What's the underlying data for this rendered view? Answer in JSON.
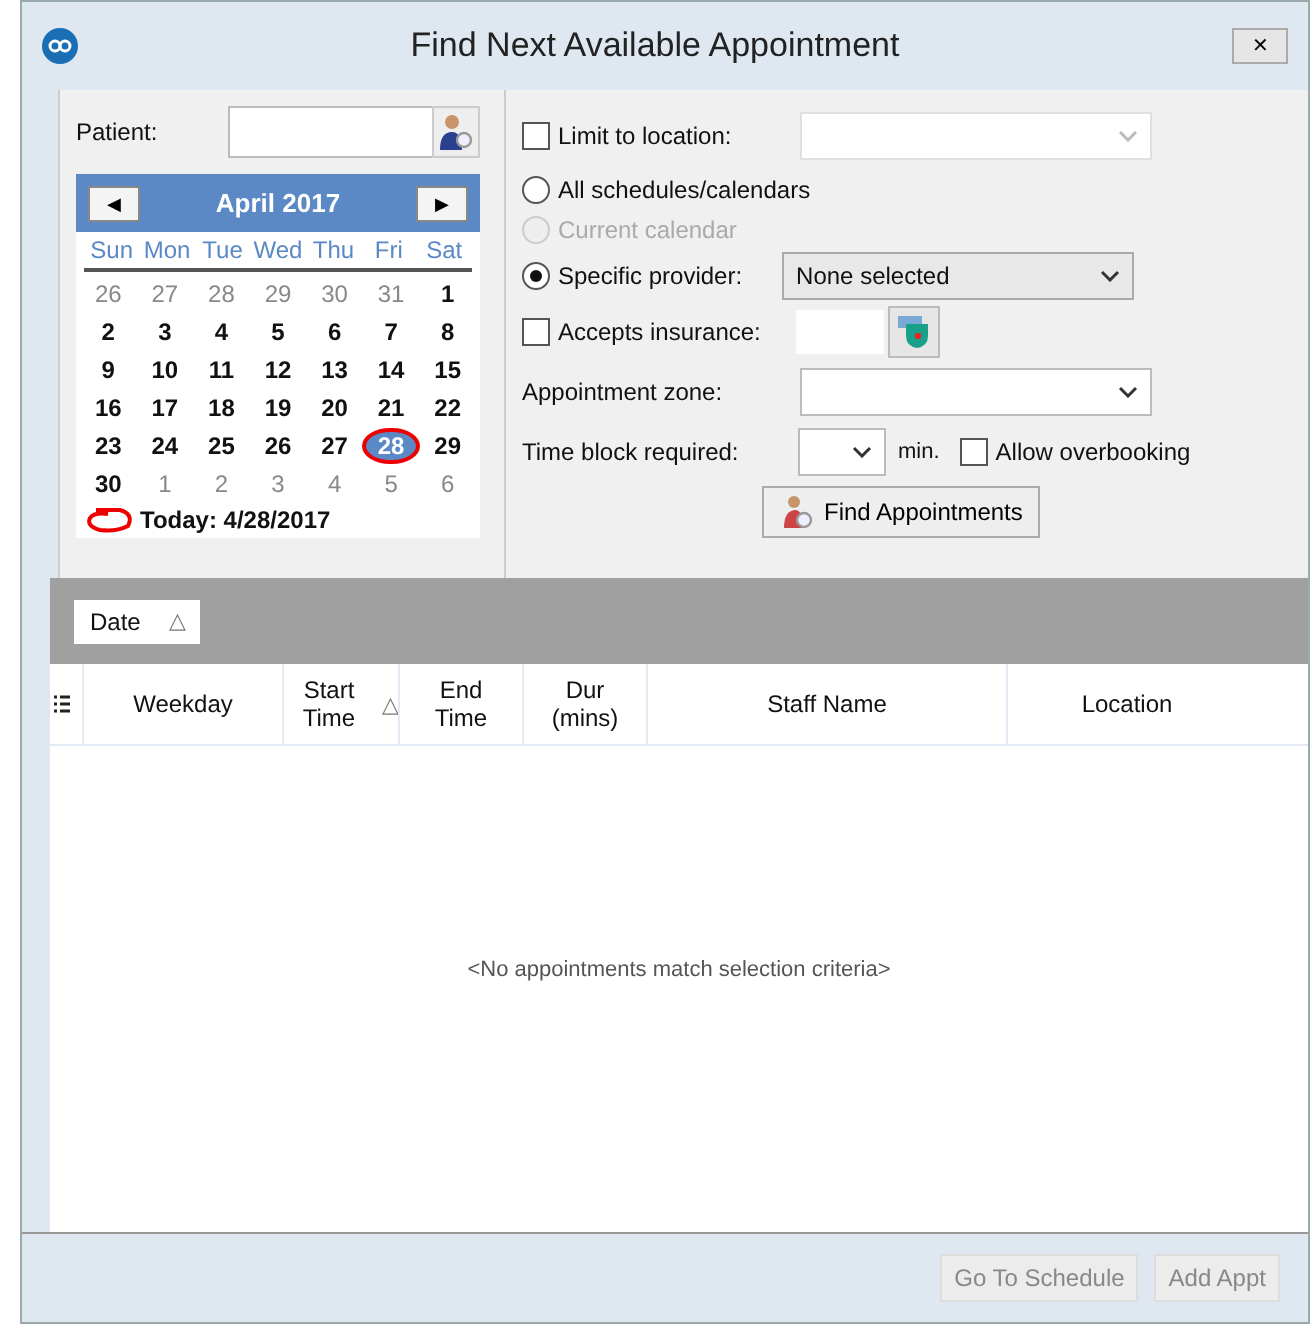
{
  "window": {
    "title": "Find Next Available Appointment",
    "close": "✕"
  },
  "patient": {
    "label": "Patient:"
  },
  "calendar": {
    "month": "April 2017",
    "prev": "◀",
    "next": "▶",
    "weekdays": [
      "Sun",
      "Mon",
      "Tue",
      "Wed",
      "Thu",
      "Fri",
      "Sat"
    ],
    "days": [
      {
        "d": "26",
        "other": true,
        "selected": false
      },
      {
        "d": "27",
        "other": true,
        "selected": false
      },
      {
        "d": "28",
        "other": true,
        "selected": false
      },
      {
        "d": "29",
        "other": true,
        "selected": false
      },
      {
        "d": "30",
        "other": true,
        "selected": false
      },
      {
        "d": "31",
        "other": true,
        "selected": false
      },
      {
        "d": "1",
        "other": false,
        "selected": false
      },
      {
        "d": "2",
        "other": false,
        "selected": false
      },
      {
        "d": "3",
        "other": false,
        "selected": false
      },
      {
        "d": "4",
        "other": false,
        "selected": false
      },
      {
        "d": "5",
        "other": false,
        "selected": false
      },
      {
        "d": "6",
        "other": false,
        "selected": false
      },
      {
        "d": "7",
        "other": false,
        "selected": false
      },
      {
        "d": "8",
        "other": false,
        "selected": false
      },
      {
        "d": "9",
        "other": false,
        "selected": false
      },
      {
        "d": "10",
        "other": false,
        "selected": false
      },
      {
        "d": "11",
        "other": false,
        "selected": false
      },
      {
        "d": "12",
        "other": false,
        "selected": false
      },
      {
        "d": "13",
        "other": false,
        "selected": false
      },
      {
        "d": "14",
        "other": false,
        "selected": false
      },
      {
        "d": "15",
        "other": false,
        "selected": false
      },
      {
        "d": "16",
        "other": false,
        "selected": false
      },
      {
        "d": "17",
        "other": false,
        "selected": false
      },
      {
        "d": "18",
        "other": false,
        "selected": false
      },
      {
        "d": "19",
        "other": false,
        "selected": false
      },
      {
        "d": "20",
        "other": false,
        "selected": false
      },
      {
        "d": "21",
        "other": false,
        "selected": false
      },
      {
        "d": "22",
        "other": false,
        "selected": false
      },
      {
        "d": "23",
        "other": false,
        "selected": false
      },
      {
        "d": "24",
        "other": false,
        "selected": false
      },
      {
        "d": "25",
        "other": false,
        "selected": false
      },
      {
        "d": "26",
        "other": false,
        "selected": false
      },
      {
        "d": "27",
        "other": false,
        "selected": false
      },
      {
        "d": "28",
        "other": false,
        "selected": true
      },
      {
        "d": "29",
        "other": false,
        "selected": false
      },
      {
        "d": "30",
        "other": false,
        "selected": false
      },
      {
        "d": "1",
        "other": true,
        "selected": false
      },
      {
        "d": "2",
        "other": true,
        "selected": false
      },
      {
        "d": "3",
        "other": true,
        "selected": false
      },
      {
        "d": "4",
        "other": true,
        "selected": false
      },
      {
        "d": "5",
        "other": true,
        "selected": false
      },
      {
        "d": "6",
        "other": true,
        "selected": false
      }
    ],
    "today": "Today: 4/28/2017"
  },
  "limit_location": {
    "label": "Limit to location:",
    "checked": false
  },
  "scope": [
    {
      "label": "All schedules/calendars",
      "selected": false,
      "disabled": false
    },
    {
      "label": "Current calendar",
      "selected": false,
      "disabled": true
    },
    {
      "label": "Specific provider:",
      "selected": true,
      "disabled": false
    }
  ],
  "provider": {
    "value": "None selected"
  },
  "accepts_insurance": {
    "label": "Accepts insurance:",
    "checked": false
  },
  "appointment_zone": {
    "label": "Appointment zone:"
  },
  "time_block": {
    "label": "Time block required:",
    "unit": "min."
  },
  "allow_overbooking": {
    "label": "Allow overbooking",
    "checked": false
  },
  "find_button": {
    "label": "Find Appointments"
  },
  "group_by": {
    "label": "Date",
    "sort": "△"
  },
  "table": {
    "columns": [
      {
        "label": "Weekday"
      },
      {
        "label": "Start Time",
        "sort": "△"
      },
      {
        "label": "End Time"
      },
      {
        "label": "Dur (mins)"
      },
      {
        "label": "Staff Name"
      },
      {
        "label": "Location"
      }
    ],
    "empty": "<No appointments match selection criteria>"
  },
  "buttons": [
    {
      "label": "Go To Schedule",
      "disabled": true
    },
    {
      "label": "Add Appt",
      "disabled": true
    }
  ]
}
